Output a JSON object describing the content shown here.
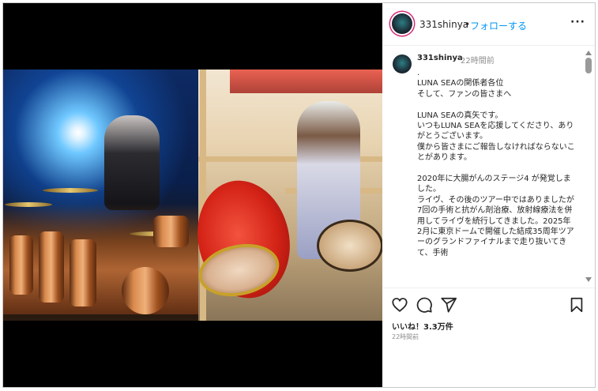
{
  "post": {
    "username": "331shinya",
    "separator": "•",
    "follow_label": "フォローする",
    "more_label": "···"
  },
  "caption": {
    "username": "331shinya",
    "time": "22時間前",
    "paragraphs": [
      ".\nLUNA SEAの関係者各位\nそして、ファンの皆さまへ",
      "LUNA SEAの真矢です。\nいつもLUNA SEAを応援してくださり、ありがとうございます。\n僕から皆さまにご報告しなければならないことがあります。",
      "2020年に大腸がんのステージ4 が発覚しました。\nライヴ、その後のツアー中ではありましたが7回の手術と抗がん剤治療、放射線療法を併用してライヴを続行してきました。2025年2月に東京ドームで開催した結成35周年ツアーのグランドファイナルまで走り抜いてきて、手術"
    ]
  },
  "actions": {
    "like_icon": "heart-icon",
    "comment_icon": "comment-icon",
    "share_icon": "send-icon",
    "save_icon": "bookmark-icon",
    "likes_text": "いいね！3.3万件",
    "posted_time": "22時間前"
  },
  "colors": {
    "follow_blue": "#0095f6",
    "story_ring": "#d62976",
    "muted": "#8e8e8e"
  }
}
